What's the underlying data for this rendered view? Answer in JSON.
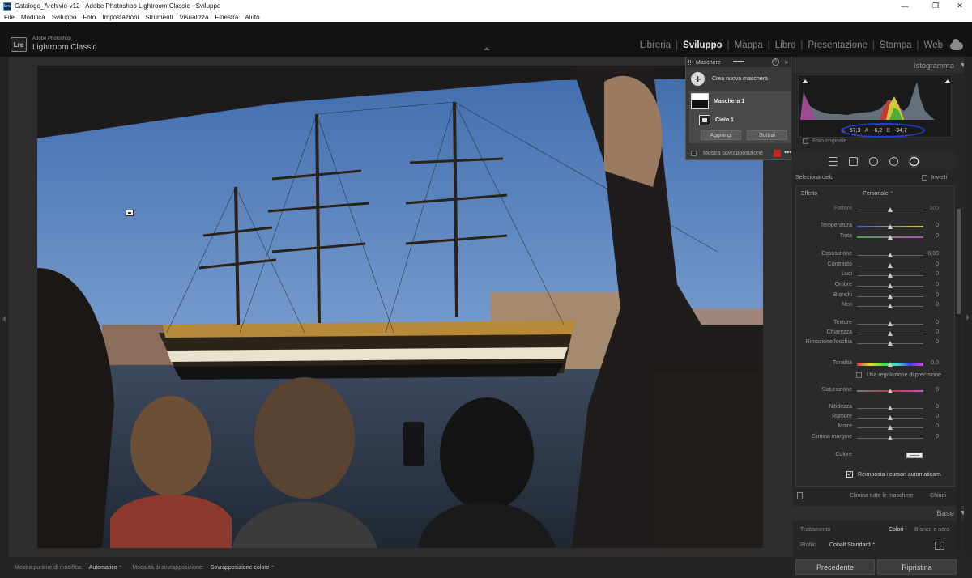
{
  "window": {
    "title": "Catalogo_Archivio-v12 - Adobe Photoshop Lightroom Classic - Sviluppo",
    "minimize": "—",
    "maximize": "❐",
    "close": "✕"
  },
  "menu": [
    "File",
    "Modifica",
    "Sviluppo",
    "Foto",
    "Impostazioni",
    "Strumenti",
    "Visualizza",
    "Finestra",
    "Aiuto"
  ],
  "brand": {
    "logo": "Lrc",
    "line1": "Adobe Photoshop",
    "line2": "Lightroom Classic"
  },
  "modules": [
    "Libreria",
    "Sviluppo",
    "Mappa",
    "Libro",
    "Presentazione",
    "Stampa",
    "Web"
  ],
  "active_module": "Sviluppo",
  "masks_panel": {
    "title": "Maschere",
    "help": "?",
    "collapse": "»",
    "create_new": "Crea nuova maschera",
    "mask_name": "Maschera 1",
    "component": "Cielo 1",
    "add": "Aggiungi",
    "subtract": "Sottrai",
    "show_overlay": "Mostra sovrapposizione",
    "overlay_color": "#d51f1f",
    "more": "•••"
  },
  "histogram": {
    "title": "Istogramma",
    "L_label": "L",
    "L": "57,3",
    "A_label": "A",
    "A": "-6,2",
    "B_label": "B",
    "B": "-34,7",
    "original_photo": "Foto originale"
  },
  "mask_adjust": {
    "select_sky": "Seleziona cielo",
    "invert": "Inverti",
    "effect_label": "Effetto",
    "effect_value": "Personale",
    "sliders": [
      {
        "label": "Fattore",
        "value": "100",
        "pos": 0.5
      },
      {
        "label": "Temperatura",
        "value": "0",
        "pos": 0.5
      },
      {
        "label": "Tinta",
        "value": "0",
        "pos": 0.5
      },
      {
        "label": "Esposizione",
        "value": "0,00",
        "pos": 0.5
      },
      {
        "label": "Contrasto",
        "value": "0",
        "pos": 0.5
      },
      {
        "label": "Luci",
        "value": "0",
        "pos": 0.5
      },
      {
        "label": "Ombre",
        "value": "0",
        "pos": 0.5
      },
      {
        "label": "Bianchi",
        "value": "0",
        "pos": 0.5
      },
      {
        "label": "Neri",
        "value": "0",
        "pos": 0.5
      },
      {
        "label": "Texture",
        "value": "0",
        "pos": 0.5
      },
      {
        "label": "Chiarezza",
        "value": "0",
        "pos": 0.5
      },
      {
        "label": "Rimozione foschia",
        "value": "0",
        "pos": 0.5
      },
      {
        "label": "Tonalità",
        "value": "0,0",
        "pos": 0.5
      },
      {
        "label": "Saturazione",
        "value": "0",
        "pos": 0.5
      },
      {
        "label": "Nitidezza",
        "value": "0",
        "pos": 0.5
      },
      {
        "label": "Rumore",
        "value": "0",
        "pos": 0.5
      },
      {
        "label": "Moiré",
        "value": "0",
        "pos": 0.5
      },
      {
        "label": "Elimina margine",
        "value": "0",
        "pos": 0.5
      }
    ],
    "precision": "Usa regolazione di precisione",
    "color": "Colore",
    "auto_reset": "Reimposta i cursori automaticam.",
    "delete_all": "Elimina tutte le maschere",
    "close": "Chiudi"
  },
  "base": {
    "title": "Base",
    "treatment": "Trattamento",
    "colors": "Colori",
    "bw": "Bianco e nero",
    "profile_label": "Profilo",
    "profile_value": "Cobalt Standard"
  },
  "buttons": {
    "previous": "Precedente",
    "reset": "Ripristina"
  },
  "toolbar": {
    "show_pins": "Mostra puntine di modifica:",
    "show_pins_value": "Automatico",
    "overlay_mode": "Modalità di sovrapposizione:",
    "overlay_mode_value": "Sovrapposizione colore"
  }
}
